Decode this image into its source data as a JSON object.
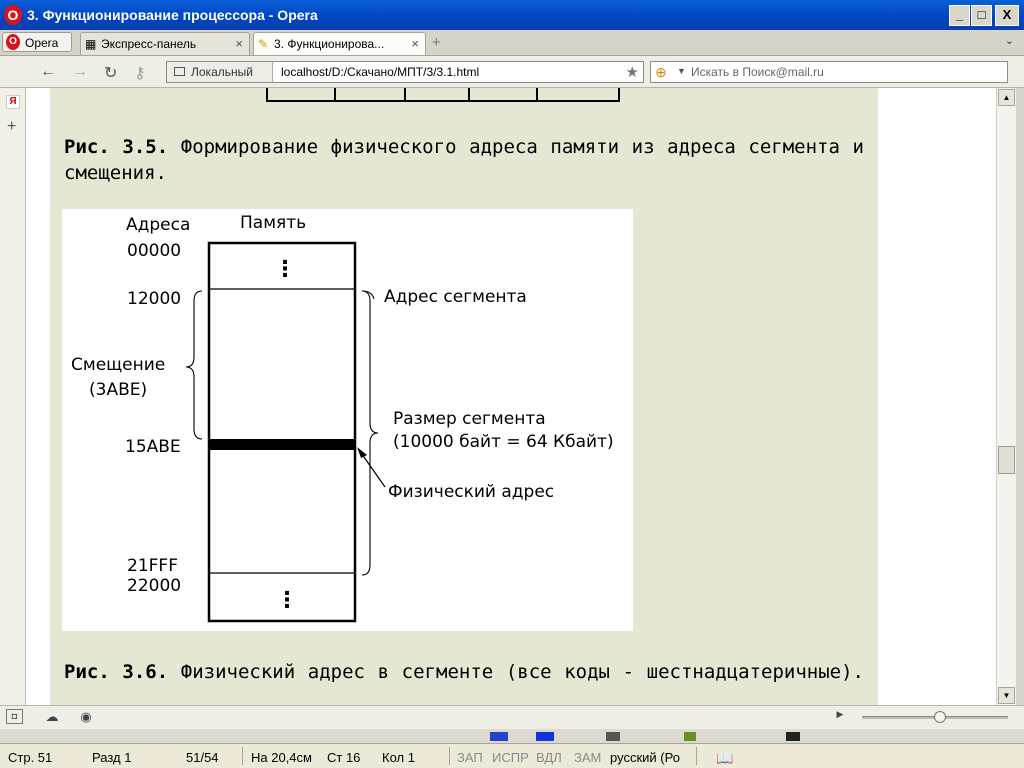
{
  "window": {
    "title": "3. Функционирование процессора - Opera",
    "buttons": [
      "_",
      "□",
      "X"
    ]
  },
  "tabbar": {
    "opera_menu_label": "Opera",
    "tabs": [
      {
        "label": "Экспресс-панель",
        "active": false
      },
      {
        "label": "3. Функционирова...",
        "active": true
      }
    ]
  },
  "navbar": {
    "address_badge": "Локальный",
    "url": "localhost/D:/Скачано/МПТ/3/3.1.html",
    "search_placeholder": "Искать в Поиск@mail.ru"
  },
  "sidepanel": {
    "yandex_label": "Я"
  },
  "document": {
    "caption_35_num": "Рис. 3.5.",
    "caption_35_text": "Формирование физического адреса памяти из адреса сегмента и смещения.",
    "caption_36_num": "Рис. 3.6.",
    "caption_36_text": "Физический адрес в сегменте (все коды - шестнадцатеричные)."
  },
  "figure": {
    "header_addresses": "Адреса",
    "header_memory": "Память",
    "addr_0": "00000",
    "addr_1": "12000",
    "addr_2": "15ABE",
    "addr_3": "21FFF",
    "addr_4": "22000",
    "offset_label": "Смещение",
    "offset_value": "(3ABE)",
    "segment_address_label": "Адрес сегмента",
    "segment_size_label": "Размер сегмента",
    "segment_size_value": "(10000 байт = 64 Кбайт)",
    "physical_address_label": "Физический адрес",
    "dots": "⋮"
  },
  "wordstatus": {
    "page": "Стр. 51",
    "section": "Разд 1",
    "pages": "51/54",
    "position": "На 20,4см",
    "line": "Ст 16",
    "column": "Кол 1",
    "rec": "ЗАП",
    "trk": "ИСПР",
    "ext": "ВДЛ",
    "ovr": "ЗАМ",
    "language": "русский (Ро"
  }
}
